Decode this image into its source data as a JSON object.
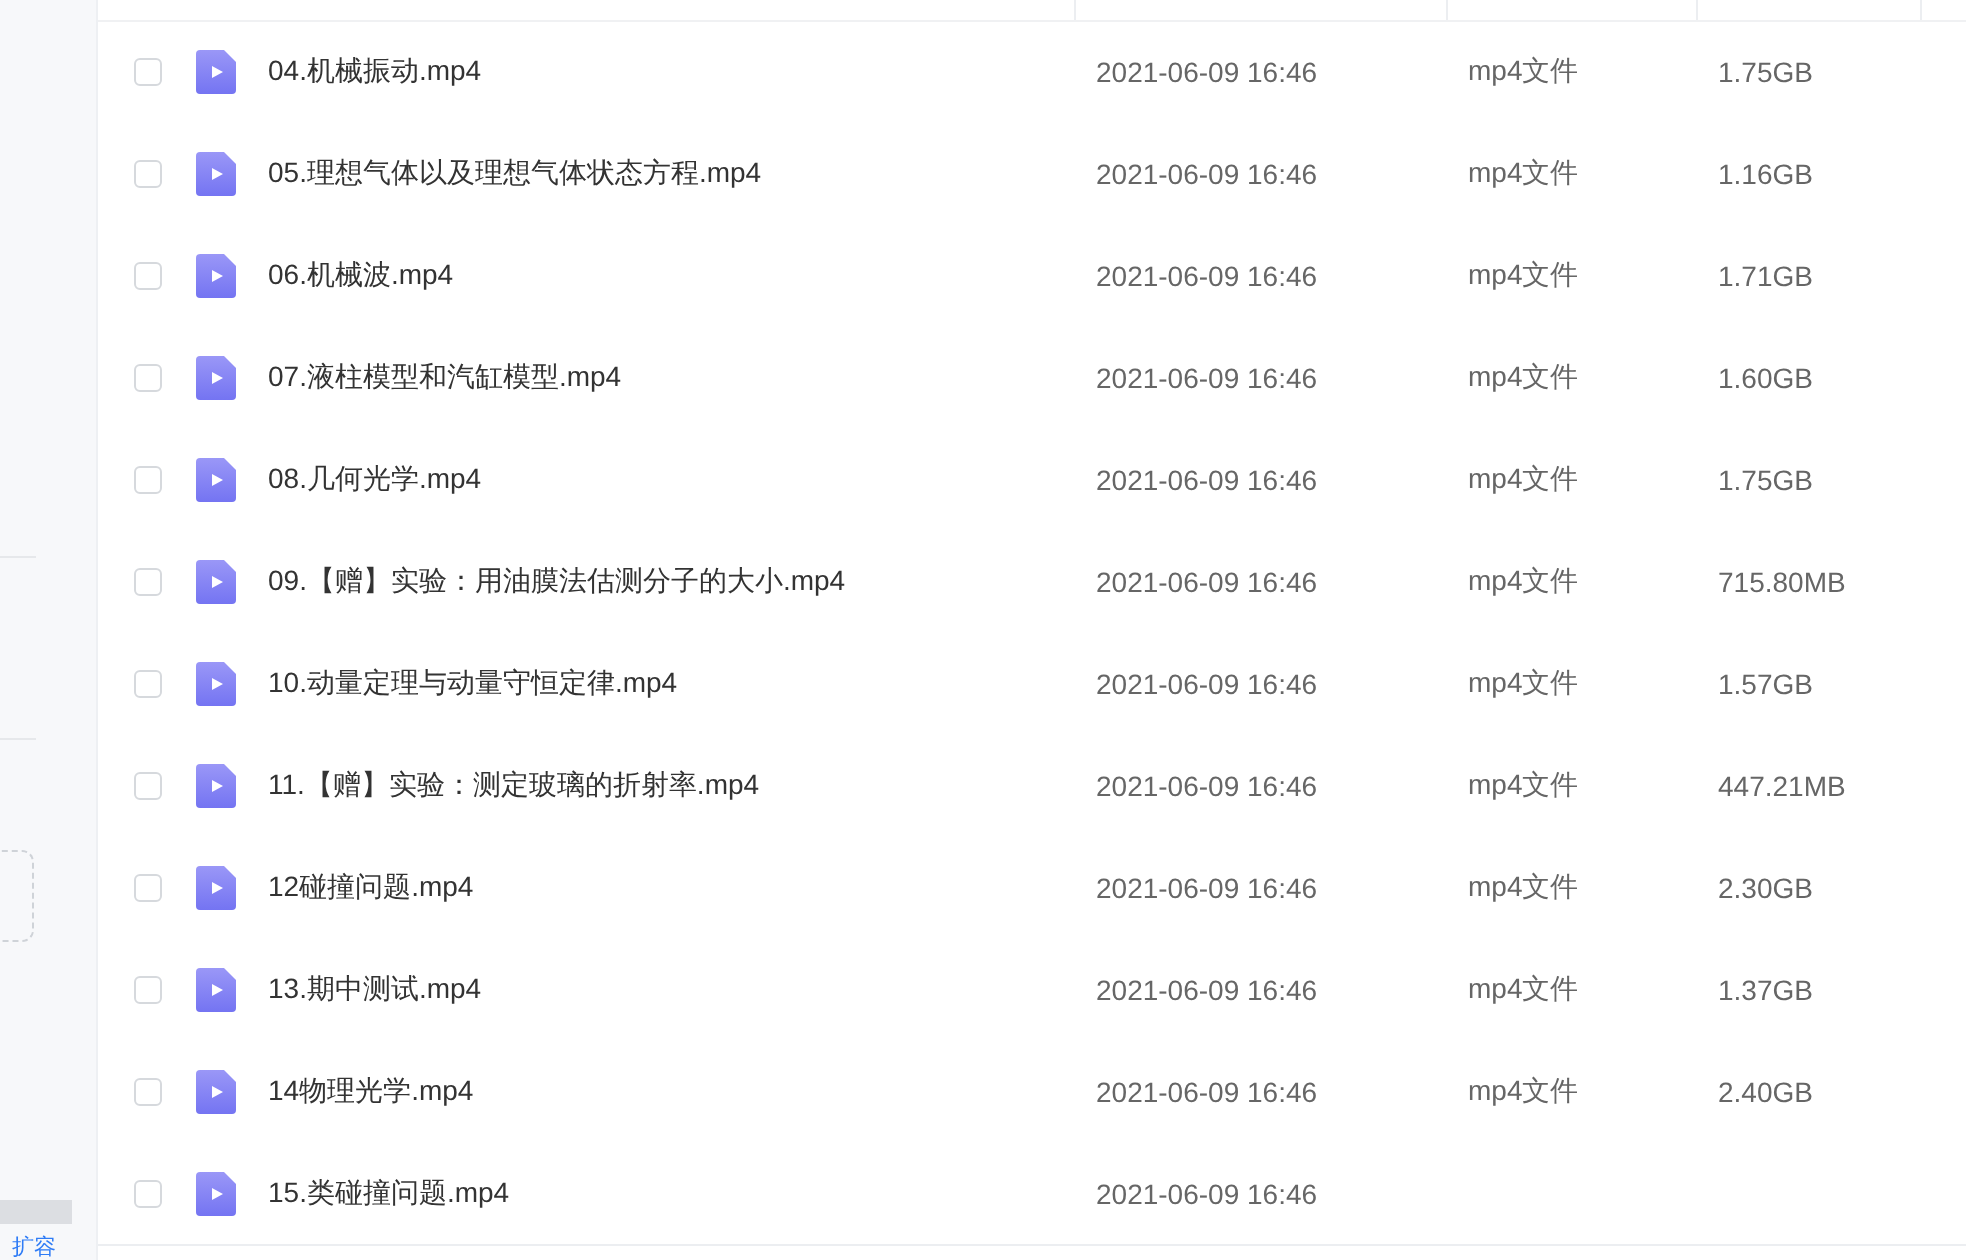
{
  "sidebar": {
    "footer_link": "扩容"
  },
  "files": [
    {
      "name": "04.机械振动.mp4",
      "modified": "2021-06-09 16:46",
      "type": "mp4文件",
      "size": "1.75GB",
      "checked": false
    },
    {
      "name": "05.理想气体以及理想气体状态方程.mp4",
      "modified": "2021-06-09 16:46",
      "type": "mp4文件",
      "size": "1.16GB",
      "checked": false
    },
    {
      "name": "06.机械波.mp4",
      "modified": "2021-06-09 16:46",
      "type": "mp4文件",
      "size": "1.71GB",
      "checked": false
    },
    {
      "name": "07.液柱模型和汽缸模型.mp4",
      "modified": "2021-06-09 16:46",
      "type": "mp4文件",
      "size": "1.60GB",
      "checked": false
    },
    {
      "name": "08.几何光学.mp4",
      "modified": "2021-06-09 16:46",
      "type": "mp4文件",
      "size": "1.75GB",
      "checked": false
    },
    {
      "name": "09.【赠】实验：用油膜法估测分子的大小.mp4",
      "modified": "2021-06-09 16:46",
      "type": "mp4文件",
      "size": "715.80MB",
      "checked": false
    },
    {
      "name": "10.动量定理与动量守恒定律.mp4",
      "modified": "2021-06-09 16:46",
      "type": "mp4文件",
      "size": "1.57GB",
      "checked": false
    },
    {
      "name": "11.【赠】实验：测定玻璃的折射率.mp4",
      "modified": "2021-06-09 16:46",
      "type": "mp4文件",
      "size": "447.21MB",
      "checked": false
    },
    {
      "name": "12碰撞问题.mp4",
      "modified": "2021-06-09 16:46",
      "type": "mp4文件",
      "size": "2.30GB",
      "checked": false
    },
    {
      "name": "13.期中测试.mp4",
      "modified": "2021-06-09 16:46",
      "type": "mp4文件",
      "size": "1.37GB",
      "checked": false
    },
    {
      "name": "14物理光学.mp4",
      "modified": "2021-06-09 16:46",
      "type": "mp4文件",
      "size": "2.40GB",
      "checked": false
    },
    {
      "name": "15.类碰撞问题.mp4",
      "modified": "2021-06-09 16:46",
      "checked": false
    }
  ]
}
